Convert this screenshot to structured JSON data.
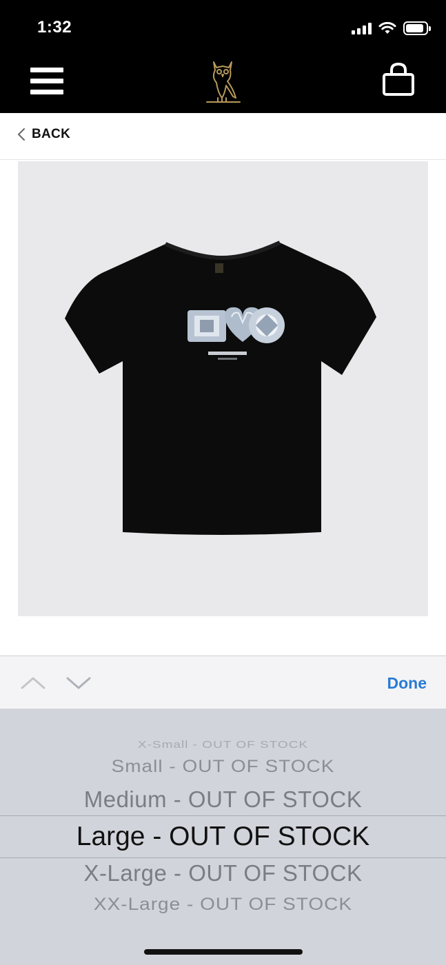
{
  "status_bar": {
    "time": "1:32"
  },
  "header": {
    "menu_icon": "hamburger-menu-icon",
    "logo_icon": "owl-logo-icon",
    "cart_icon": "shopping-bag-icon"
  },
  "back": {
    "label": "BACK"
  },
  "product": {
    "image_desc_icon": "black-tshirt-diamond-graphic"
  },
  "picker": {
    "done_label": "Done",
    "options": [
      "X-Small - OUT OF STOCK",
      "Small - OUT OF STOCK",
      "Medium - OUT OF STOCK",
      "Large - OUT OF STOCK",
      "X-Large - OUT OF STOCK",
      "XX-Large - OUT OF STOCK"
    ],
    "selected_index": 3
  },
  "colors": {
    "accent": "#2a7bd4",
    "header_bg": "#000000",
    "logo_gold": "#b8995a"
  }
}
